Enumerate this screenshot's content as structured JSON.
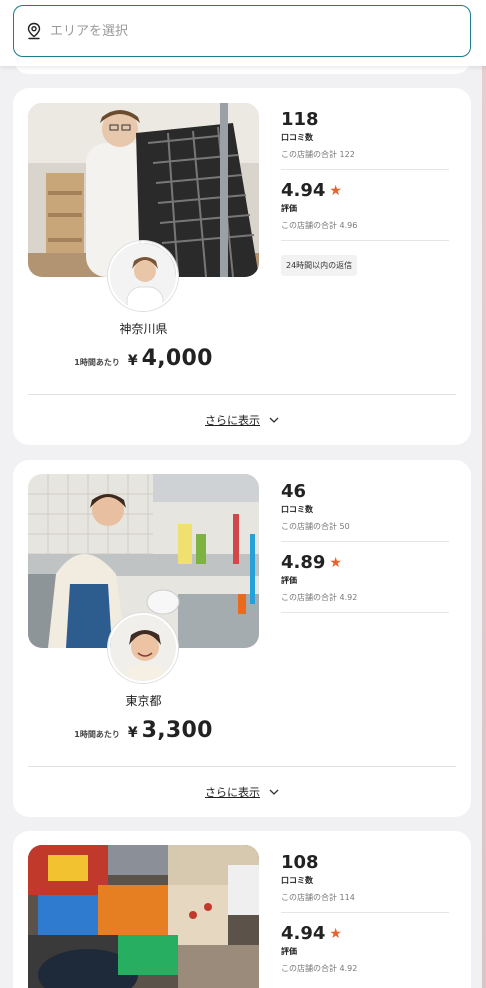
{
  "search": {
    "placeholder": "エリアを選択"
  },
  "colors": {
    "accent": "#1f7a8c",
    "star": "#e8622b"
  },
  "listings": [
    {
      "location": "神奈川県",
      "price_unit": "1時間あたり",
      "currency": "¥",
      "price": "4,000",
      "reviews": {
        "count": "118",
        "label": "口コミ数",
        "store_total": "この店舗の合計 122"
      },
      "rating": {
        "value": "4.94",
        "label": "評価",
        "store_total": "この店舗の合計 4.96"
      },
      "badge": "24時間以内の返信",
      "more_label": "さらに表示"
    },
    {
      "location": "東京都",
      "price_unit": "1時間あたり",
      "currency": "¥",
      "price": "3,300",
      "reviews": {
        "count": "46",
        "label": "口コミ数",
        "store_total": "この店舗の合計 50"
      },
      "rating": {
        "value": "4.89",
        "label": "評価",
        "store_total": "この店舗の合計 4.92"
      },
      "more_label": "さらに表示"
    },
    {
      "reviews": {
        "count": "108",
        "label": "口コミ数",
        "store_total": "この店舗の合計 114"
      },
      "rating": {
        "value": "4.94",
        "label": "評価",
        "store_total": "この店舗の合計 4.92"
      }
    }
  ],
  "icons": {
    "location": "map-pin-icon",
    "star": "star-icon",
    "chevron": "chevron-down-icon"
  }
}
